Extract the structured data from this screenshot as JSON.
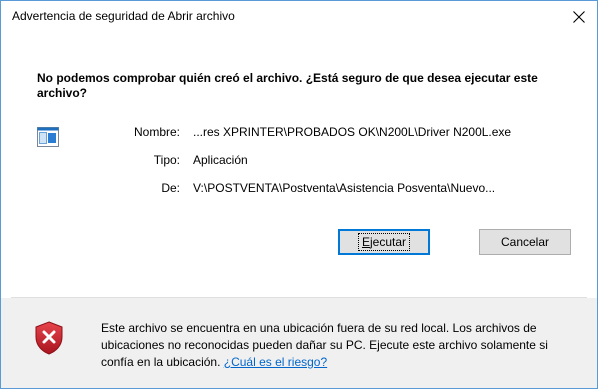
{
  "dialog": {
    "title": "Advertencia de seguridad de Abrir archivo",
    "question": "No podemos comprobar quién creó el archivo. ¿Está seguro de que desea ejecutar este archivo?"
  },
  "details": {
    "name_label": "Nombre:",
    "name_value": "...res XPRINTER\\PROBADOS OK\\N200L\\Driver N200L.exe",
    "type_label": "Tipo:",
    "type_value": "Aplicación",
    "from_label": "De:",
    "from_value": "V:\\POSTVENTA\\Postventa\\Asistencia Posventa\\Nuevo..."
  },
  "buttons": {
    "run_label": "Ejecutar",
    "run_mnemonic": "E",
    "run_rest": "jecutar",
    "cancel_label": "Cancelar"
  },
  "warning": {
    "text": "Este archivo se encuentra en una ubicación fuera de su red local. Los archivos de ubicaciones no reconocidas pueden dañar su PC. Ejecute este archivo solamente si confía en la ubicación.",
    "link": "¿Cuál es el riesgo?"
  },
  "icons": {
    "close": "close-icon",
    "file": "application-file-icon",
    "warning": "security-shield-icon"
  },
  "colors": {
    "window_border": "#5a9ad6",
    "default_button_border": "#0078d7",
    "link": "#0066cc",
    "shield_red": "#c8202b",
    "footer_bg": "#f0f0f0"
  }
}
